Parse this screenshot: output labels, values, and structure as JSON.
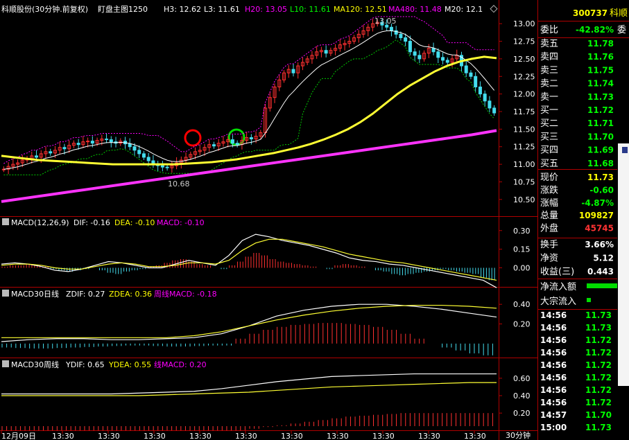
{
  "quote_panel": {
    "code": "300737",
    "name": "科顺",
    "weibi_label": "委比",
    "weibi_value": "-42.82%",
    "weicha_label": "委",
    "sell_levels": [
      {
        "label": "卖五",
        "price": "11.78"
      },
      {
        "label": "卖四",
        "price": "11.76"
      },
      {
        "label": "卖三",
        "price": "11.75"
      },
      {
        "label": "卖二",
        "price": "11.74"
      },
      {
        "label": "卖一",
        "price": "11.73"
      }
    ],
    "buy_levels": [
      {
        "label": "买一",
        "price": "11.72"
      },
      {
        "label": "买二",
        "price": "11.71"
      },
      {
        "label": "买三",
        "price": "11.70"
      },
      {
        "label": "买四",
        "price": "11.69"
      },
      {
        "label": "买五",
        "price": "11.68"
      }
    ],
    "stats": [
      {
        "label": "现价",
        "value": "11.73",
        "color": "#ffff00"
      },
      {
        "label": "涨跌",
        "value": "-0.60",
        "color": "#00ff00"
      },
      {
        "label": "涨幅",
        "value": "-4.87%",
        "color": "#00ff00"
      },
      {
        "label": "总量",
        "value": "109827",
        "color": "#ffff00"
      },
      {
        "label": "外盘",
        "value": "45745",
        "color": "#ff3333"
      },
      {
        "label": "换手",
        "value": "3.66%",
        "color": "#ffffff"
      },
      {
        "label": "净资",
        "value": "5.12",
        "color": "#ffffff"
      },
      {
        "label": "收益(三)",
        "value": "0.443",
        "color": "#ffffff"
      }
    ],
    "netflow_label": "净流入额",
    "bigflow_label": "大宗流入",
    "ticks": [
      {
        "time": "14:56",
        "price": "11.73"
      },
      {
        "time": "14:56",
        "price": "11.73"
      },
      {
        "time": "14:56",
        "price": "11.72"
      },
      {
        "time": "14:56",
        "price": "11.72"
      },
      {
        "time": "14:56",
        "price": "11.72"
      },
      {
        "time": "14:56",
        "price": "11.72"
      },
      {
        "time": "14:56",
        "price": "11.72"
      },
      {
        "time": "14:56",
        "price": "11.72"
      },
      {
        "time": "14:57",
        "price": "11.70"
      },
      {
        "time": "15:00",
        "price": "11.73"
      }
    ]
  },
  "chart_data": [
    {
      "type": "candlestick",
      "panel": "price",
      "title": "科顺股份(30分钟.前复权)",
      "indicator_name": "盯盘主图1250",
      "legend": [
        {
          "label": "H3: 12.62",
          "color": "#ffffff"
        },
        {
          "label": "L3: 11.61",
          "color": "#ffffff"
        },
        {
          "label": "H20: 13.05",
          "color": "#ff00ff"
        },
        {
          "label": "L10: 11.61",
          "color": "#00ff00"
        },
        {
          "label": "MA120: 12.51",
          "color": "#ffff00"
        },
        {
          "label": "MA480: 11.48",
          "color": "#ff00ff"
        },
        {
          "label": "M20: 12.1",
          "color": "#ffffff"
        }
      ],
      "y_ticks": [
        "13.00",
        "12.75",
        "12.50",
        "12.25",
        "12.00",
        "11.75",
        "11.50",
        "11.25",
        "11.00",
        "10.75",
        "10.50"
      ],
      "ylim": [
        10.38,
        13.12
      ],
      "annotations": [
        {
          "label": "13.05"
        },
        {
          "label": "10.68"
        }
      ],
      "closes": [
        10.93,
        10.97,
        11.0,
        11.02,
        11.06,
        11.08,
        11.12,
        11.1,
        11.15,
        11.18,
        11.16,
        11.2,
        11.24,
        11.22,
        11.27,
        11.3,
        11.28,
        11.32,
        11.33,
        11.3,
        11.34,
        11.36,
        11.35,
        11.32,
        11.3,
        11.33,
        11.29,
        11.25,
        11.2,
        11.15,
        11.1,
        11.05,
        11.0,
        10.98,
        10.96,
        10.95,
        10.98,
        11.02,
        11.06,
        11.1,
        11.14,
        11.18,
        11.2,
        11.24,
        11.28,
        11.26,
        11.3,
        11.32,
        11.35,
        11.3,
        11.28,
        11.34,
        11.38,
        11.36,
        11.4,
        11.45,
        11.8,
        11.95,
        12.1,
        12.2,
        12.3,
        12.35,
        12.3,
        12.4,
        12.45,
        12.5,
        12.55,
        12.6,
        12.62,
        12.58,
        12.62,
        12.65,
        12.7,
        12.72,
        12.75,
        12.8,
        12.85,
        12.9,
        12.95,
        13.0,
        13.02,
        12.98,
        12.95,
        12.9,
        12.85,
        12.8,
        12.75,
        12.6,
        12.55,
        12.5,
        12.58,
        12.65,
        12.6,
        12.52,
        12.48,
        12.45,
        12.5,
        12.55,
        12.4,
        12.3,
        12.25,
        12.1,
        12.0,
        11.9,
        11.8,
        11.73
      ],
      "ma120": [
        11.12,
        11.1,
        11.08,
        11.06,
        11.05,
        11.04,
        11.03,
        11.02,
        11.01,
        11.0,
        11.0,
        11.0,
        11.0,
        11.0,
        11.0,
        11.01,
        11.02,
        11.03,
        11.05,
        11.07,
        11.1,
        11.13,
        11.16,
        11.2,
        11.24,
        11.29,
        11.35,
        11.42,
        11.5,
        11.6,
        11.72,
        11.86,
        12.0,
        12.12,
        12.22,
        12.32,
        12.4,
        12.46,
        12.5,
        12.53,
        12.51
      ],
      "ma480": [
        10.47,
        10.52,
        10.57,
        10.62,
        10.67,
        10.72,
        10.77,
        10.82,
        10.87,
        10.92,
        10.97,
        11.02,
        11.07,
        11.12,
        11.17,
        11.22,
        11.27,
        11.32,
        11.37,
        11.42,
        11.48
      ]
    },
    {
      "type": "histogram+line",
      "panel": "macd",
      "title": "MACD(12,26,9)",
      "legend": [
        {
          "label": "DIF: -0.16",
          "color": "#ffffff"
        },
        {
          "label": "DEA: -0.10",
          "color": "#ffff00"
        },
        {
          "label": "MACD: -0.10",
          "color": "#ff00ff"
        }
      ],
      "y_ticks": [
        "0.30",
        "0.15",
        "0.00"
      ],
      "ylim": [
        -0.12,
        0.36
      ],
      "bars": [
        0.01,
        0.02,
        0.02,
        0.03,
        0.02,
        0.01,
        -0.01,
        -0.02,
        -0.03,
        -0.02,
        -0.01,
        0.0,
        -0.02,
        -0.04,
        -0.05,
        -0.03,
        -0.02,
        -0.01,
        0.01,
        0.02,
        0.04,
        0.06,
        0.07,
        0.05,
        0.03,
        0.02,
        0.0,
        -0.01,
        0.02,
        0.05,
        0.09,
        0.12,
        0.1,
        0.07,
        0.05,
        0.04,
        0.03,
        0.02,
        0.01,
        0.0,
        -0.01,
        0.02,
        0.03,
        0.02,
        0.01,
        0.0,
        -0.02,
        -0.03,
        -0.05,
        -0.06,
        -0.05,
        -0.04,
        -0.03,
        -0.02,
        -0.01,
        -0.02,
        -0.03,
        -0.04,
        -0.05,
        -0.08,
        -0.1
      ],
      "dif": [
        0.03,
        0.04,
        0.03,
        0.01,
        -0.02,
        -0.03,
        -0.01,
        0.02,
        0.05,
        0.04,
        0.02,
        0.0,
        0.0,
        0.03,
        0.06,
        0.04,
        0.02,
        0.1,
        0.22,
        0.27,
        0.25,
        0.22,
        0.2,
        0.18,
        0.15,
        0.12,
        0.08,
        0.06,
        0.05,
        0.03,
        0.02,
        0.0,
        -0.02,
        -0.04,
        -0.06,
        -0.08,
        -0.1,
        -0.16
      ],
      "dea": [
        0.02,
        0.03,
        0.03,
        0.02,
        0.0,
        -0.01,
        -0.01,
        0.01,
        0.03,
        0.04,
        0.03,
        0.01,
        0.01,
        0.02,
        0.04,
        0.04,
        0.03,
        0.06,
        0.14,
        0.2,
        0.23,
        0.23,
        0.21,
        0.19,
        0.17,
        0.14,
        0.11,
        0.09,
        0.07,
        0.05,
        0.04,
        0.02,
        0.0,
        -0.02,
        -0.04,
        -0.06,
        -0.08,
        -0.1
      ]
    },
    {
      "type": "histogram+line",
      "panel": "macd_daily",
      "title": "MACD30日线",
      "legend": [
        {
          "label": "ZDIF: 0.27",
          "color": "#ffffff"
        },
        {
          "label": "ZDEA: 0.36",
          "color": "#ffff00"
        },
        {
          "label": "周线MACD: -0.18",
          "color": "#ff00ff"
        }
      ],
      "y_ticks": [
        "0.40",
        "0.20"
      ],
      "ylim": [
        -0.1,
        0.5
      ],
      "bars": [
        -0.04,
        -0.045,
        -0.05,
        -0.05,
        -0.045,
        -0.04,
        -0.035,
        -0.03,
        -0.025,
        -0.02,
        -0.02,
        -0.025,
        -0.03,
        -0.03,
        -0.025,
        -0.02,
        -0.02,
        0.05,
        0.1,
        0.14,
        0.17,
        0.19,
        0.2,
        0.21,
        0.21,
        0.2,
        0.19,
        0.17,
        0.14,
        0.1,
        0.05,
        0.0,
        -0.04,
        -0.07,
        -0.1,
        -0.12
      ],
      "dif": [
        0.02,
        0.04,
        0.05,
        0.05,
        0.04,
        0.04,
        0.05,
        0.06,
        0.1,
        0.18,
        0.28,
        0.34,
        0.38,
        0.4,
        0.4,
        0.38,
        0.35,
        0.31,
        0.27
      ],
      "dea": [
        0.06,
        0.06,
        0.06,
        0.06,
        0.06,
        0.06,
        0.06,
        0.08,
        0.12,
        0.18,
        0.24,
        0.29,
        0.33,
        0.36,
        0.38,
        0.39,
        0.39,
        0.38,
        0.36
      ]
    },
    {
      "type": "histogram+line",
      "panel": "macd_weekly",
      "title": "MACD30周线",
      "legend": [
        {
          "label": "YDIF: 0.65",
          "color": "#ffffff"
        },
        {
          "label": "YDEA: 0.55",
          "color": "#ffff00"
        },
        {
          "label": "线MACD: 0.20",
          "color": "#ff00ff"
        }
      ],
      "y_ticks": [
        "0.60",
        "0.40",
        "0.20"
      ],
      "ylim": [
        0.05,
        0.75
      ],
      "bars": [
        0.0,
        0.0,
        0.0,
        0.0,
        0.0,
        0.0,
        0.0,
        0.0,
        0.0,
        0.0,
        0.0,
        0.0,
        0.0,
        0.0,
        0.0,
        0.0,
        0.0,
        0.0,
        0.02,
        0.04,
        0.06,
        0.08,
        0.1,
        0.12,
        0.14,
        0.16,
        0.17,
        0.18,
        0.19,
        0.2,
        0.2,
        0.2,
        0.2,
        0.2,
        0.2,
        0.2
      ],
      "dif": [
        0.42,
        0.42,
        0.42,
        0.42,
        0.42,
        0.43,
        0.44,
        0.45,
        0.48,
        0.52,
        0.56,
        0.59,
        0.62,
        0.63,
        0.64,
        0.65,
        0.65,
        0.65,
        0.65
      ],
      "dea": [
        0.4,
        0.4,
        0.4,
        0.4,
        0.4,
        0.4,
        0.41,
        0.42,
        0.43,
        0.44,
        0.46,
        0.48,
        0.5,
        0.51,
        0.52,
        0.53,
        0.54,
        0.55,
        0.55
      ]
    }
  ],
  "x_axis": {
    "ticks": [
      "12月09日",
      "13:30",
      "13:30",
      "13:30",
      "13:30",
      "13:30",
      "13:30",
      "13:30",
      "13:30",
      "13:30",
      "13:30"
    ],
    "period_label": "30分钟"
  }
}
